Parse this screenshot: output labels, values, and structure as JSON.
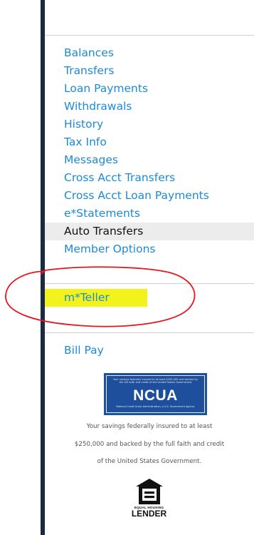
{
  "nav": {
    "items": [
      {
        "label": "Balances"
      },
      {
        "label": "Transfers"
      },
      {
        "label": "Loan Payments"
      },
      {
        "label": "Withdrawals"
      },
      {
        "label": "History"
      },
      {
        "label": "Tax Info"
      },
      {
        "label": "Messages"
      },
      {
        "label": "Cross Acct Transfers"
      },
      {
        "label": "Cross Acct Loan Payments"
      },
      {
        "label": "e*Statements"
      },
      {
        "label": "Auto Transfers"
      },
      {
        "label": "Member Options"
      }
    ],
    "active_item": "Auto Transfers"
  },
  "mteller": {
    "label": "m*Teller",
    "highlight_color": "#f2f31a",
    "annotation_color": "#e8151b"
  },
  "billpay": {
    "label": "Bill Pay"
  },
  "ncua": {
    "top_text": "Your savings federally insured to at least $250,000 and backed by the full faith and credit of the United States Government",
    "logo_text": "NCUA",
    "bottom_text": "National Credit Union Administration, a U.S. Government Agency",
    "color": "#1e4f9c"
  },
  "insurance_note": {
    "line1": "Your savings federally insured to at least",
    "line2": "$250,000 and backed by the full faith and credit",
    "line3": "of the United States Government."
  },
  "equal_housing": {
    "icon": "equal-housing-icon",
    "line1": "EQUAL HOUSING",
    "line2": "LENDER"
  },
  "colors": {
    "link": "#1d8ad6",
    "sidebar_bar": "#1b2a44",
    "active_bg": "#ececec"
  }
}
